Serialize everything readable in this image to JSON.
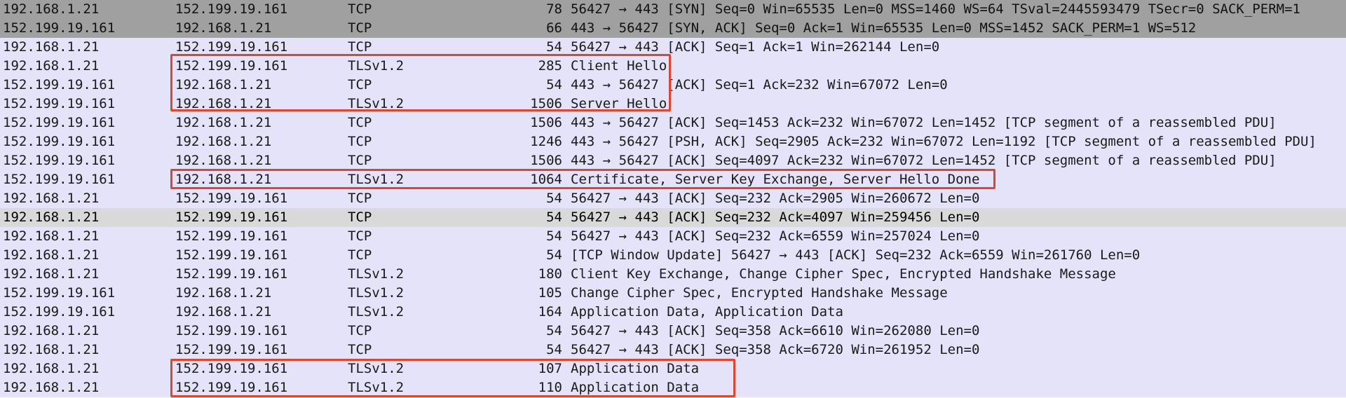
{
  "rows": [
    {
      "src": "192.168.1.21",
      "dst": "152.199.19.161",
      "proto": "TCP",
      "len": "78",
      "info": "56427 → 443 [SYN] Seq=0 Win=65535 Len=0 MSS=1460 WS=64 TSval=2445593479 TSecr=0 SACK_PERM=1"
    },
    {
      "src": "152.199.19.161",
      "dst": "192.168.1.21",
      "proto": "TCP",
      "len": "66",
      "info": "443 → 56427 [SYN, ACK] Seq=0 Ack=1 Win=65535 Len=0 MSS=1452 SACK_PERM=1 WS=512"
    },
    {
      "src": "192.168.1.21",
      "dst": "152.199.19.161",
      "proto": "TCP",
      "len": "54",
      "info": "56427 → 443 [ACK] Seq=1 Ack=1 Win=262144 Len=0"
    },
    {
      "src": "192.168.1.21",
      "dst": "152.199.19.161",
      "proto": "TLSv1.2",
      "len": "285",
      "info": "Client Hello"
    },
    {
      "src": "152.199.19.161",
      "dst": "192.168.1.21",
      "proto": "TCP",
      "len": "54",
      "info": "443 → 56427 [ACK] Seq=1 Ack=232 Win=67072 Len=0"
    },
    {
      "src": "152.199.19.161",
      "dst": "192.168.1.21",
      "proto": "TLSv1.2",
      "len": "1506",
      "info": "Server Hello"
    },
    {
      "src": "152.199.19.161",
      "dst": "192.168.1.21",
      "proto": "TCP",
      "len": "1506",
      "info": "443 → 56427 [ACK] Seq=1453 Ack=232 Win=67072 Len=1452 [TCP segment of a reassembled PDU]"
    },
    {
      "src": "152.199.19.161",
      "dst": "192.168.1.21",
      "proto": "TCP",
      "len": "1246",
      "info": "443 → 56427 [PSH, ACK] Seq=2905 Ack=232 Win=67072 Len=1192 [TCP segment of a reassembled PDU]"
    },
    {
      "src": "152.199.19.161",
      "dst": "192.168.1.21",
      "proto": "TCP",
      "len": "1506",
      "info": "443 → 56427 [ACK] Seq=4097 Ack=232 Win=67072 Len=1452 [TCP segment of a reassembled PDU]"
    },
    {
      "src": "152.199.19.161",
      "dst": "192.168.1.21",
      "proto": "TLSv1.2",
      "len": "1064",
      "info": "Certificate, Server Key Exchange, Server Hello Done"
    },
    {
      "src": "192.168.1.21",
      "dst": "152.199.19.161",
      "proto": "TCP",
      "len": "54",
      "info": "56427 → 443 [ACK] Seq=232 Ack=2905 Win=260672 Len=0"
    },
    {
      "src": "192.168.1.21",
      "dst": "152.199.19.161",
      "proto": "TCP",
      "len": "54",
      "info": "56427 → 443 [ACK] Seq=232 Ack=4097 Win=259456 Len=0"
    },
    {
      "src": "192.168.1.21",
      "dst": "152.199.19.161",
      "proto": "TCP",
      "len": "54",
      "info": "56427 → 443 [ACK] Seq=232 Ack=6559 Win=257024 Len=0"
    },
    {
      "src": "192.168.1.21",
      "dst": "152.199.19.161",
      "proto": "TCP",
      "len": "54",
      "info": "[TCP Window Update] 56427 → 443 [ACK] Seq=232 Ack=6559 Win=261760 Len=0"
    },
    {
      "src": "192.168.1.21",
      "dst": "152.199.19.161",
      "proto": "TLSv1.2",
      "len": "180",
      "info": "Client Key Exchange, Change Cipher Spec, Encrypted Handshake Message"
    },
    {
      "src": "152.199.19.161",
      "dst": "192.168.1.21",
      "proto": "TLSv1.2",
      "len": "105",
      "info": "Change Cipher Spec, Encrypted Handshake Message"
    },
    {
      "src": "152.199.19.161",
      "dst": "192.168.1.21",
      "proto": "TLSv1.2",
      "len": "164",
      "info": "Application Data, Application Data"
    },
    {
      "src": "192.168.1.21",
      "dst": "152.199.19.161",
      "proto": "TCP",
      "len": "54",
      "info": "56427 → 443 [ACK] Seq=358 Ack=6610 Win=262080 Len=0"
    },
    {
      "src": "192.168.1.21",
      "dst": "152.199.19.161",
      "proto": "TCP",
      "len": "54",
      "info": "56427 → 443 [ACK] Seq=358 Ack=6720 Win=261952 Len=0"
    },
    {
      "src": "192.168.1.21",
      "dst": "152.199.19.161",
      "proto": "TLSv1.2",
      "len": "107",
      "info": "Application Data"
    },
    {
      "src": "192.168.1.21",
      "dst": "152.199.19.161",
      "proto": "TLSv1.2",
      "len": "110",
      "info": "Application Data"
    }
  ],
  "colors": {
    "row_default": "#e5e3f9",
    "row_syn": "#a0a0a0",
    "row_selected": "#d9d9d9",
    "annotation_box": "#e0452e"
  }
}
